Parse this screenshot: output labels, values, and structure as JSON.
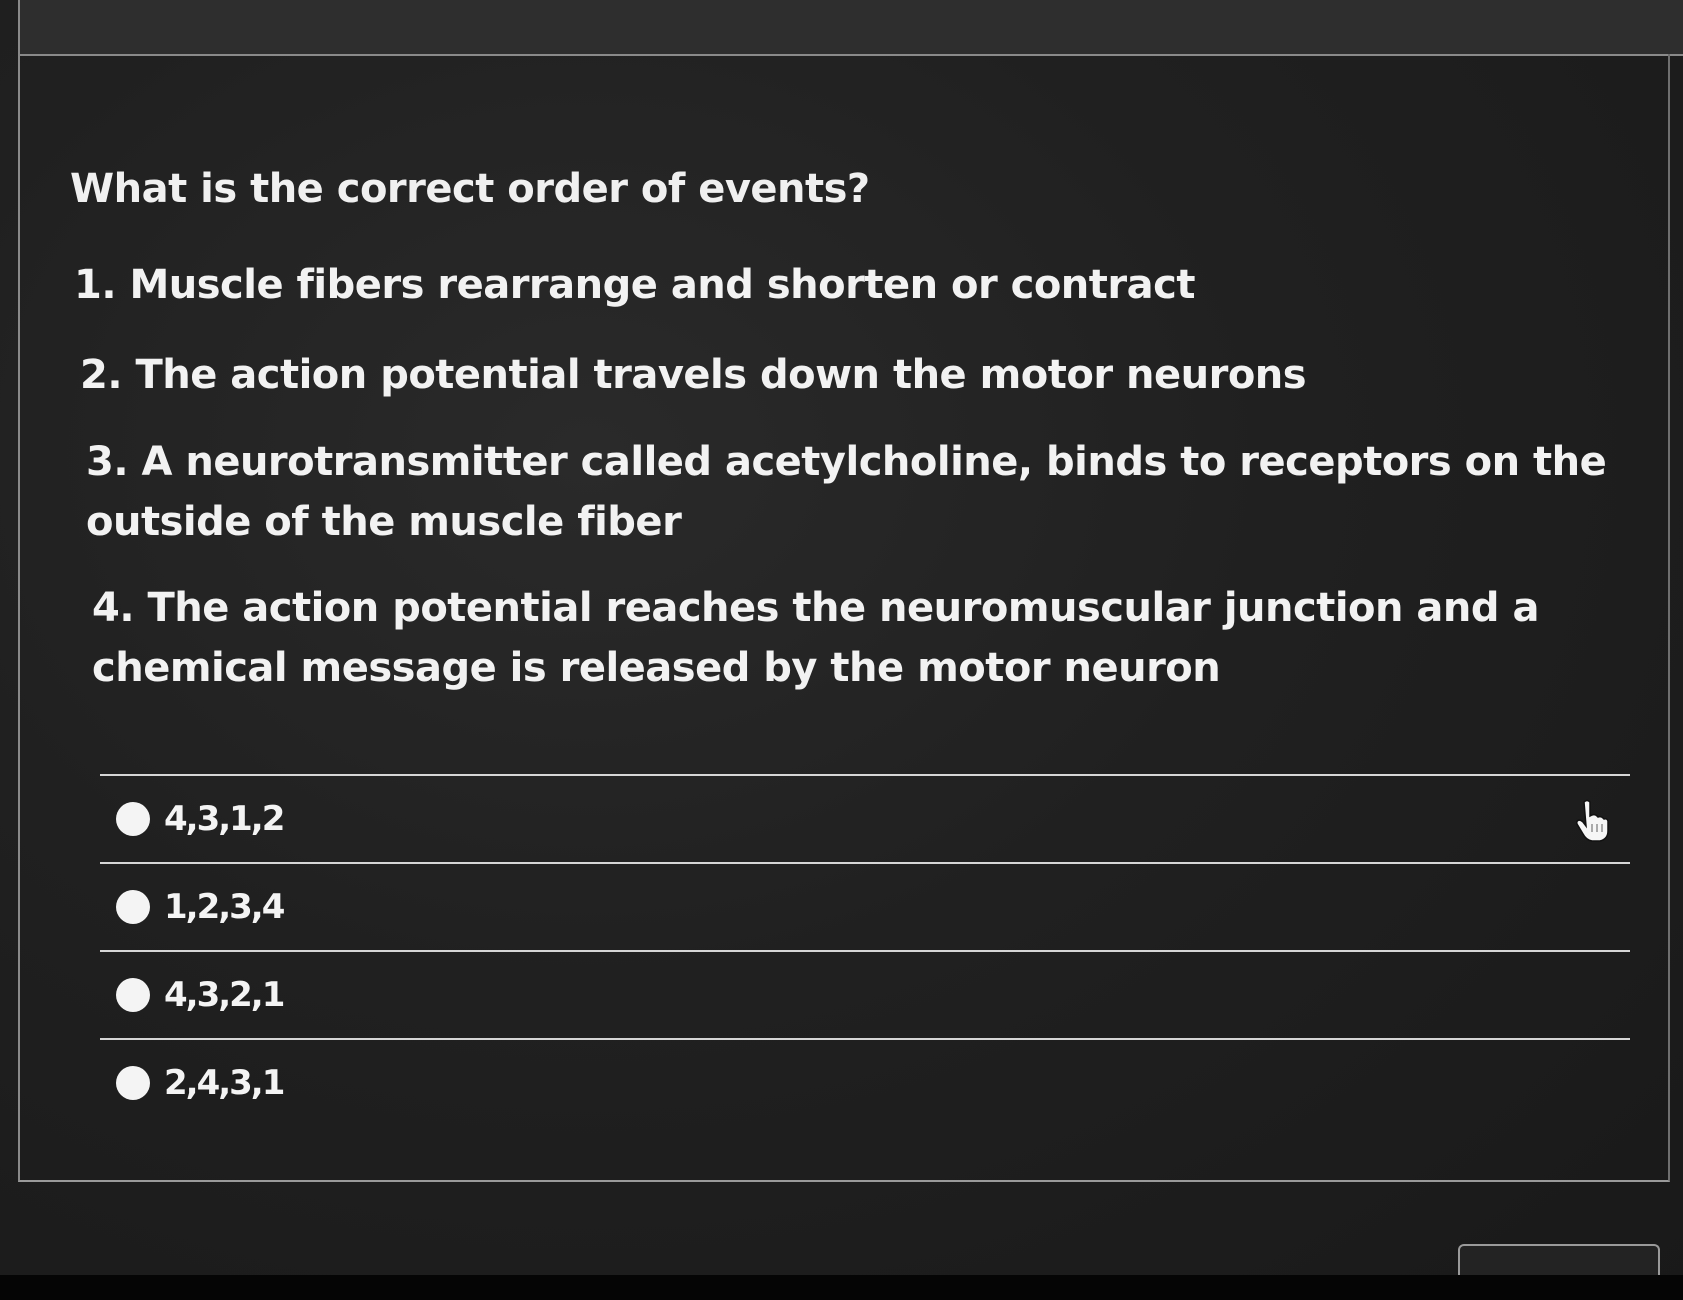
{
  "question": {
    "prompt": "What is the correct order of events?",
    "steps": [
      "1. Muscle fibers rearrange and shorten or contract",
      "2. The action potential travels down the motor neurons",
      "3. A neurotransmitter called acetylcholine, binds to receptors on the outside of the muscle fiber",
      "4. The action potential reaches the neuromuscular junction and a chemical message is released by the motor neuron"
    ]
  },
  "options": [
    {
      "label": "4,3,1,2",
      "selected": false
    },
    {
      "label": "1,2,3,4",
      "selected": false
    },
    {
      "label": "4,3,2,1",
      "selected": false
    },
    {
      "label": "2,4,3,1",
      "selected": false
    }
  ],
  "cursor": {
    "icon": "hand-pointer-icon"
  },
  "colors": {
    "background": "#202020",
    "text": "#f2f2f2",
    "divider": "#d6d6d6",
    "radio": "#f4f4f4"
  }
}
